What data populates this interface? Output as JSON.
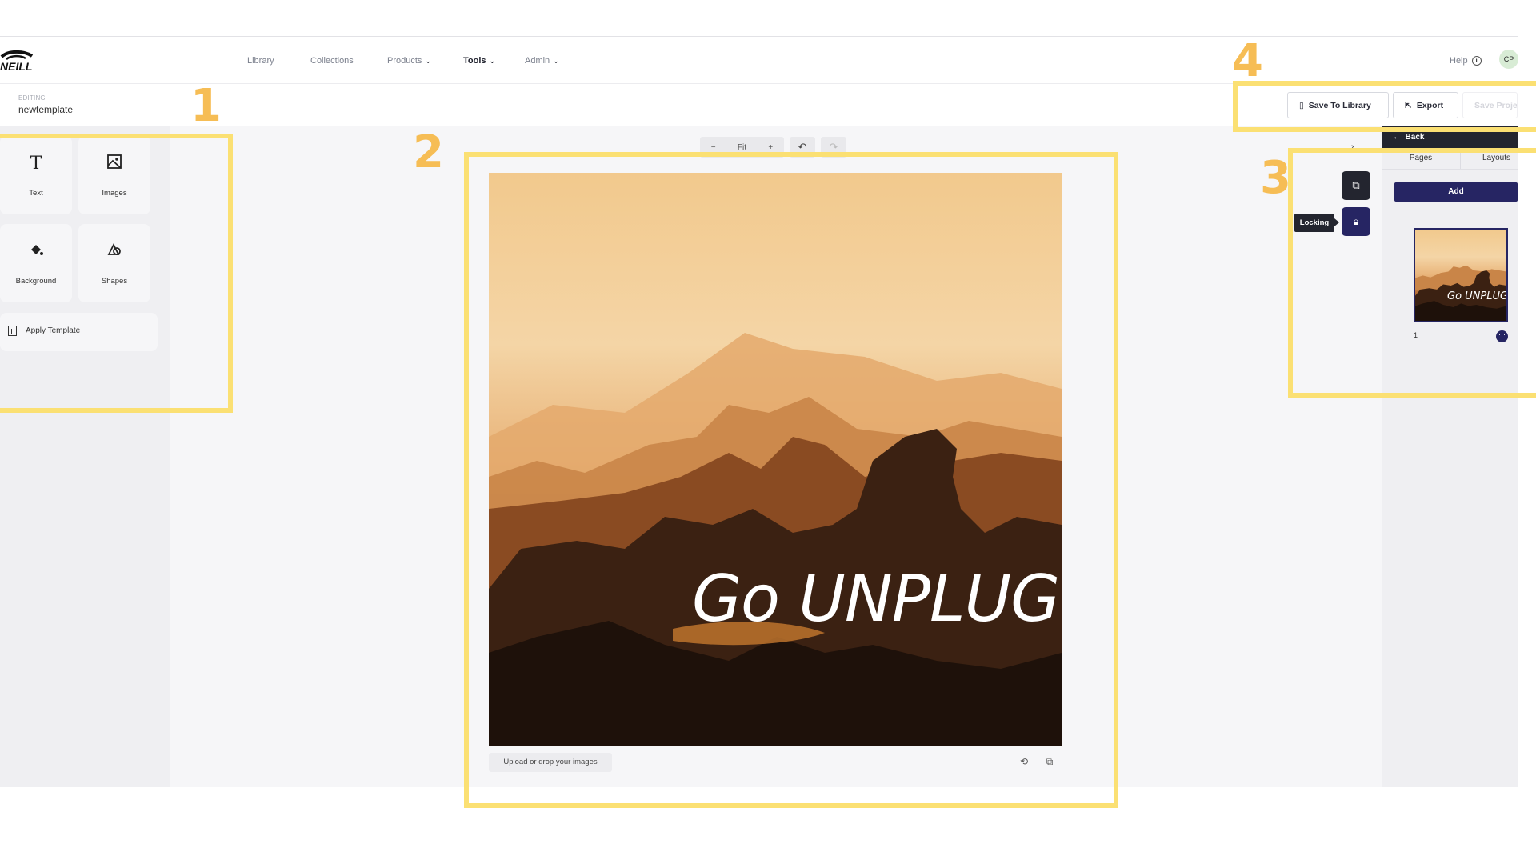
{
  "nav": {
    "logo_text": "O'NEILL",
    "items": [
      {
        "label": "Library",
        "chevron": false,
        "active": false
      },
      {
        "label": "Collections",
        "chevron": false,
        "active": false
      },
      {
        "label": "Products",
        "chevron": true,
        "active": false
      },
      {
        "label": "Tools",
        "chevron": true,
        "active": true
      },
      {
        "label": "Admin",
        "chevron": true,
        "active": false
      }
    ],
    "help_label": "Help",
    "help_icon": "info-icon",
    "avatar_initials": "CP"
  },
  "editing": {
    "label": "EDITING",
    "name": "newtemplate"
  },
  "actions": {
    "save_library": "Save To Library",
    "export": "Export",
    "save_project": "Save Proje"
  },
  "tools": [
    {
      "label": "Text",
      "icon": "text-icon",
      "glyph": "T"
    },
    {
      "label": "Images",
      "icon": "image-icon",
      "glyph": "🖼"
    },
    {
      "label": "Background",
      "icon": "paint-bucket-icon",
      "glyph": "◈"
    },
    {
      "label": "Shapes",
      "icon": "shapes-icon",
      "glyph": "◭"
    }
  ],
  "apply_template": "Apply Template",
  "zoom": {
    "minus": "−",
    "fit": "Fit",
    "plus": "+"
  },
  "canvas": {
    "headline": "Go UNPLUG",
    "upload_label": "Upload or drop your images"
  },
  "side_tools": {
    "tooltip": "Locking"
  },
  "right_panel": {
    "back": "Back",
    "tabs": [
      "Pages",
      "Layouts"
    ],
    "add": "Add",
    "page_number": "1",
    "thumb_text": "Go UNPLUG"
  },
  "annotations": [
    "1",
    "2",
    "3",
    "4"
  ],
  "colors": {
    "primary": "#262563",
    "dark": "#23252f",
    "highlight": "#fbe073",
    "annotation_number": "#f6bd55"
  }
}
